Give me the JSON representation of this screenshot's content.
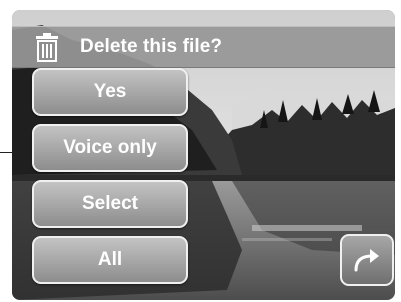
{
  "header": {
    "title": "Delete this file?",
    "icon": "trash-icon"
  },
  "menu": {
    "items": [
      {
        "label": "Yes"
      },
      {
        "label": "Voice only"
      },
      {
        "label": "Select"
      },
      {
        "label": "All"
      }
    ]
  },
  "return_button": {
    "icon": "return-arrow-icon"
  },
  "colors": {
    "header_bg": "#969696",
    "button_bg": "#a9a9a9",
    "button_border": "#f0f0f0",
    "text": "#ffffff"
  }
}
